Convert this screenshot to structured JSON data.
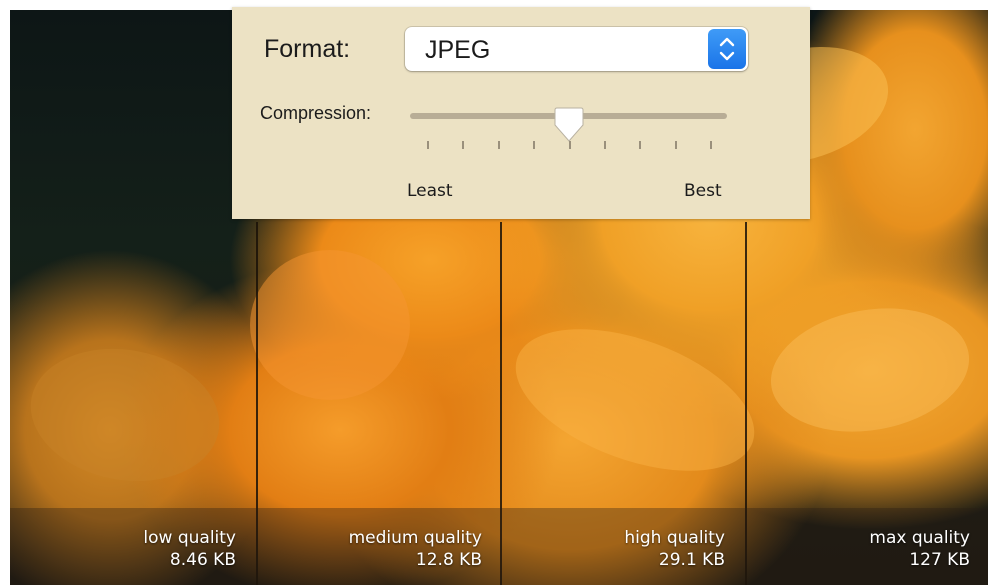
{
  "dialog": {
    "format_label": "Format:",
    "format_value": "JPEG",
    "compression_label": "Compression:",
    "compression_level": 0.5,
    "slider_min_label": "Least",
    "slider_max_label": "Best",
    "tick_count": 9
  },
  "photo": {
    "subject": "orange-flower-photo",
    "panels": [
      {
        "quality": "low quality",
        "size": "8.46 KB"
      },
      {
        "quality": "medium quality",
        "size": "12.8 KB"
      },
      {
        "quality": "high quality",
        "size": "29.1 KB"
      },
      {
        "quality": "max quality",
        "size": "127 KB"
      }
    ]
  },
  "colors": {
    "dialog_bg": "#ece2c4",
    "stepper_accent": "#2a84f0",
    "petal_orange": "#f0a026",
    "background_dark": "#0d1616"
  }
}
